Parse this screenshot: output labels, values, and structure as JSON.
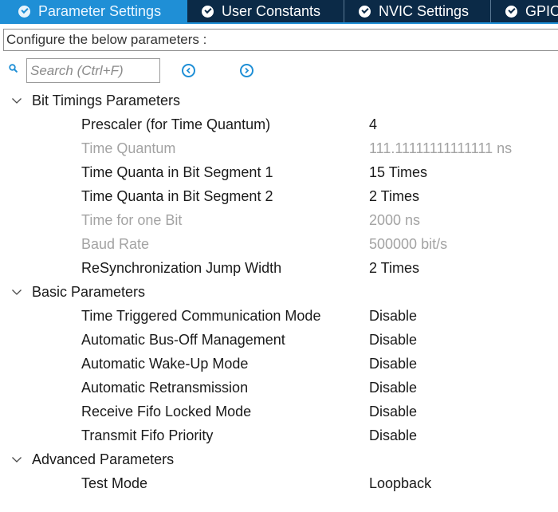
{
  "tabs": [
    {
      "label": "Parameter Settings",
      "active": true
    },
    {
      "label": "User Constants",
      "active": false
    },
    {
      "label": "NVIC Settings",
      "active": false
    },
    {
      "label": "GPIO Settings",
      "active": false
    }
  ],
  "description": "Configure the below parameters :",
  "search": {
    "placeholder": "Search (Ctrl+F)"
  },
  "groups": [
    {
      "title": "Bit Timings Parameters",
      "params": [
        {
          "name": "Prescaler (for Time Quantum)",
          "value": "4",
          "readonly": false
        },
        {
          "name": "Time Quantum",
          "value": "111.11111111111111 ns",
          "readonly": true
        },
        {
          "name": "Time Quanta in Bit Segment 1",
          "value": "15 Times",
          "readonly": false
        },
        {
          "name": "Time Quanta in Bit Segment 2",
          "value": "2 Times",
          "readonly": false
        },
        {
          "name": "Time for one Bit",
          "value": "2000 ns",
          "readonly": true
        },
        {
          "name": "Baud Rate",
          "value": "500000 bit/s",
          "readonly": true
        },
        {
          "name": "ReSynchronization Jump Width",
          "value": "2 Times",
          "readonly": false
        }
      ]
    },
    {
      "title": "Basic Parameters",
      "params": [
        {
          "name": "Time Triggered Communication Mode",
          "value": "Disable",
          "readonly": false
        },
        {
          "name": "Automatic Bus-Off Management",
          "value": "Disable",
          "readonly": false
        },
        {
          "name": "Automatic Wake-Up Mode",
          "value": "Disable",
          "readonly": false
        },
        {
          "name": "Automatic Retransmission",
          "value": "Disable",
          "readonly": false
        },
        {
          "name": "Receive Fifo Locked Mode",
          "value": "Disable",
          "readonly": false
        },
        {
          "name": "Transmit Fifo Priority",
          "value": "Disable",
          "readonly": false
        }
      ]
    },
    {
      "title": "Advanced Parameters",
      "params": [
        {
          "name": "Test Mode",
          "value": "Loopback",
          "readonly": false
        }
      ]
    }
  ],
  "colors": {
    "tabbar_bg": "#0b2a47",
    "tab_active_bg": "#1f8fd6",
    "accent": "#1f8fd6",
    "readonly_text": "#a3a3a3"
  }
}
